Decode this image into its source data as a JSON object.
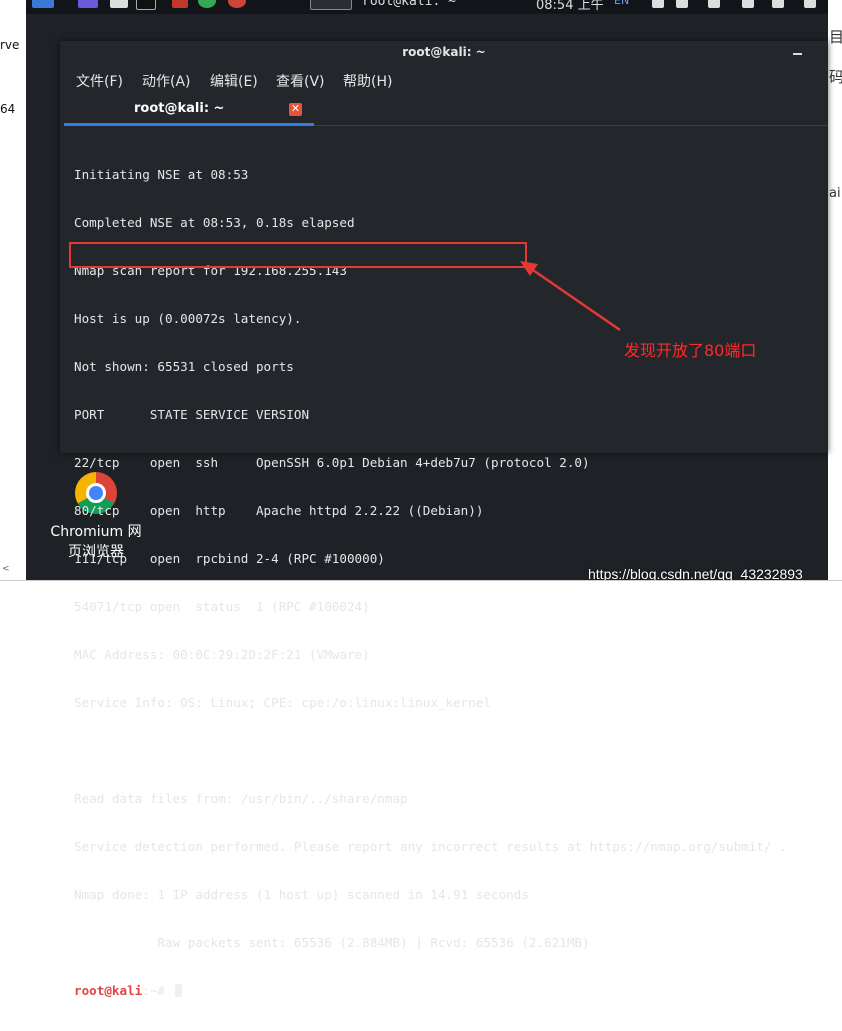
{
  "left_app": {
    "line1": "rve",
    "line2": "64"
  },
  "right_app": {
    "line1": "目",
    "line2": "码",
    "line3": "ai"
  },
  "topbar": {
    "window_title": "root@kali: ~",
    "clock": "08:54 上午",
    "lang": "EN"
  },
  "terminal": {
    "title": "root@kali: ~",
    "menu": [
      "文件(F)",
      "动作(A)",
      "编辑(E)",
      "查看(V)",
      "帮助(H)"
    ],
    "tab": {
      "label": "root@kali: ~",
      "close": "✕"
    },
    "lines": [
      "Initiating NSE at 08:53",
      "Completed NSE at 08:53, 0.18s elapsed",
      "Nmap scan report for 192.168.255.143",
      "Host is up (0.00072s latency).",
      "Not shown: 65531 closed ports",
      "PORT      STATE SERVICE VERSION",
      "22/tcp    open  ssh     OpenSSH 6.0p1 Debian 4+deb7u7 (protocol 2.0)",
      "80/tcp    open  http    Apache httpd 2.2.22 ((Debian))",
      "111/tcp   open  rpcbind 2-4 (RPC #100000)",
      "54071/tcp open  status  1 (RPC #100024)",
      "MAC Address: 00:0C:29:2D:2F:21 (VMware)",
      "Service Info: OS: Linux; CPE: cpe:/o:linux:linux_kernel",
      "",
      "Read data files from: /usr/bin/../share/nmap",
      "Service detection performed. Please report any incorrect results at https://nmap.org/submit/ .",
      "Nmap done: 1 IP address (1 host up) scanned in 14.91 seconds",
      "           Raw packets sent: 65536 (2.884MB) | Rcvd: 65536 (2.621MB)"
    ],
    "prompt": {
      "user": "root@kali",
      "path": ":~# "
    }
  },
  "annotation": "发现开放了80端口",
  "desktop_icon": {
    "line1": "Chromium 网",
    "line2": "页浏览器"
  },
  "watermark": "https://blog.csdn.net/qq_43232893",
  "colors": {
    "terminal_bg": "#23262b",
    "highlight": "#e53935",
    "annotation": "#ff2a2a",
    "tab_accent": "#2f7fe0",
    "prompt_user": "#e04545"
  }
}
